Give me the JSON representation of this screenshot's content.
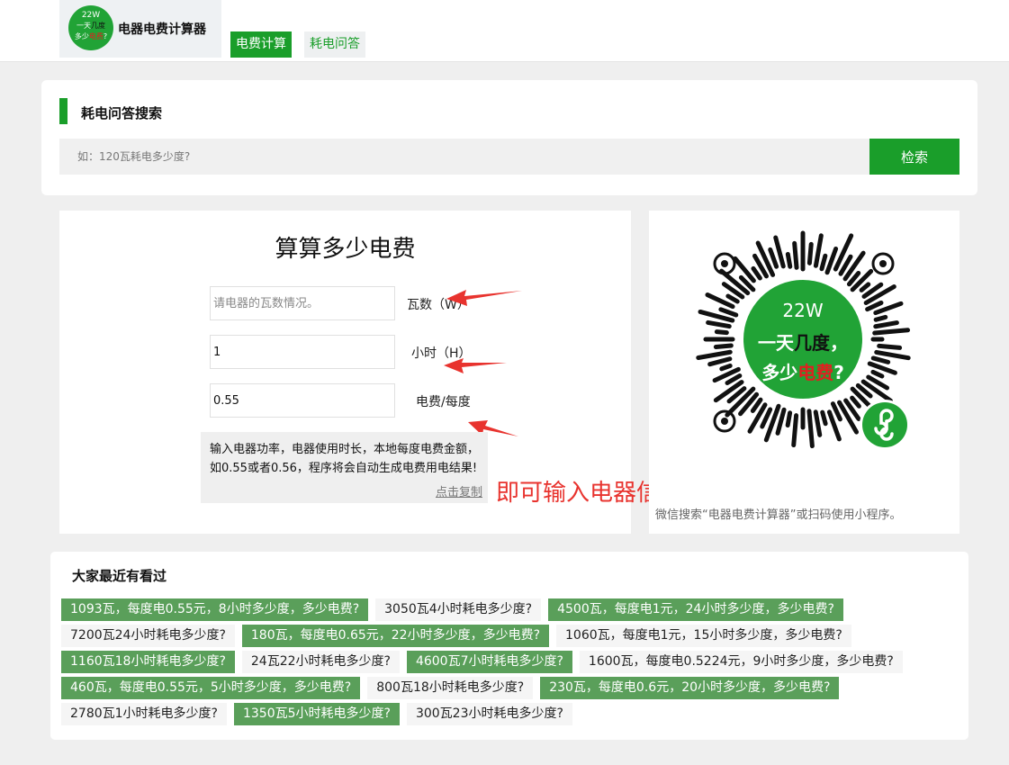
{
  "header": {
    "brand_name": "电器电费计算器",
    "logo": {
      "line1": "22W",
      "line2a": "一天",
      "line2b": "几度",
      "line3a": "多少",
      "line3b": "电费",
      "line3c": "?"
    },
    "tabs": [
      {
        "label": "电费计算",
        "active": true
      },
      {
        "label": "耗电问答",
        "active": false
      }
    ]
  },
  "search": {
    "title": "耗电问答搜索",
    "placeholder": "如：120瓦耗电多少度?",
    "button": "检索"
  },
  "calculator": {
    "title": "算算多少电费",
    "fields": [
      {
        "placeholder": "请电器的瓦数情况。",
        "value": "",
        "label": "瓦数（W）"
      },
      {
        "placeholder": "",
        "value": "1",
        "label": "小时（H）"
      },
      {
        "placeholder": "",
        "value": "0.55",
        "label": "电费/每度"
      }
    ],
    "info": "输入电器功率，电器使用时长，本地每度电费金额，如0.55或者0.56，程序将会自动生成电费用电结果!",
    "copy_link": "点击复制",
    "overlay": "即可输入电器信息计算耗电情况"
  },
  "qr": {
    "center_line1": "22W",
    "center_line2a": "一天",
    "center_line2b": "几度",
    "center_line2c": "，",
    "center_line3a": "多少",
    "center_line3b": "电费",
    "center_line3c": "?",
    "caption": "微信搜索“电器电费计算器”或扫码使用小程序。"
  },
  "recent": {
    "title": "大家最近有看过",
    "rows": [
      [
        {
          "text": "1093瓦，每度电0.55元，8小时多少度，多少电费?",
          "style": "g"
        },
        {
          "text": "3050瓦4小时耗电多少度?",
          "style": "w"
        },
        {
          "text": "4500瓦，每度电1元，24小时多少度，多少电费?",
          "style": "g"
        }
      ],
      [
        {
          "text": "7200瓦24小时耗电多少度?",
          "style": "w"
        },
        {
          "text": "180瓦，每度电0.65元，22小时多少度，多少电费?",
          "style": "g"
        },
        {
          "text": "1060瓦，每度电1元，15小时多少度，多少电费?",
          "style": "w"
        }
      ],
      [
        {
          "text": "1160瓦18小时耗电多少度?",
          "style": "g"
        },
        {
          "text": "24瓦22小时耗电多少度?",
          "style": "w"
        },
        {
          "text": "4600瓦7小时耗电多少度?",
          "style": "g"
        },
        {
          "text": "1600瓦，每度电0.5224元，9小时多少度，多少电费?",
          "style": "w"
        }
      ],
      [
        {
          "text": "460瓦，每度电0.55元，5小时多少度，多少电费?",
          "style": "g"
        },
        {
          "text": "800瓦18小时耗电多少度?",
          "style": "w"
        },
        {
          "text": "230瓦，每度电0.6元，20小时多少度，多少电费?",
          "style": "g"
        }
      ],
      [
        {
          "text": "2780瓦1小时耗电多少度?",
          "style": "w"
        },
        {
          "text": "1350瓦5小时耗电多少度?",
          "style": "g"
        },
        {
          "text": "300瓦23小时耗电多少度?",
          "style": "w"
        }
      ]
    ]
  },
  "colors": {
    "accent": "#1a9e2a",
    "tag_green": "#5a9f5a",
    "annotation_red": "#e8332e"
  }
}
